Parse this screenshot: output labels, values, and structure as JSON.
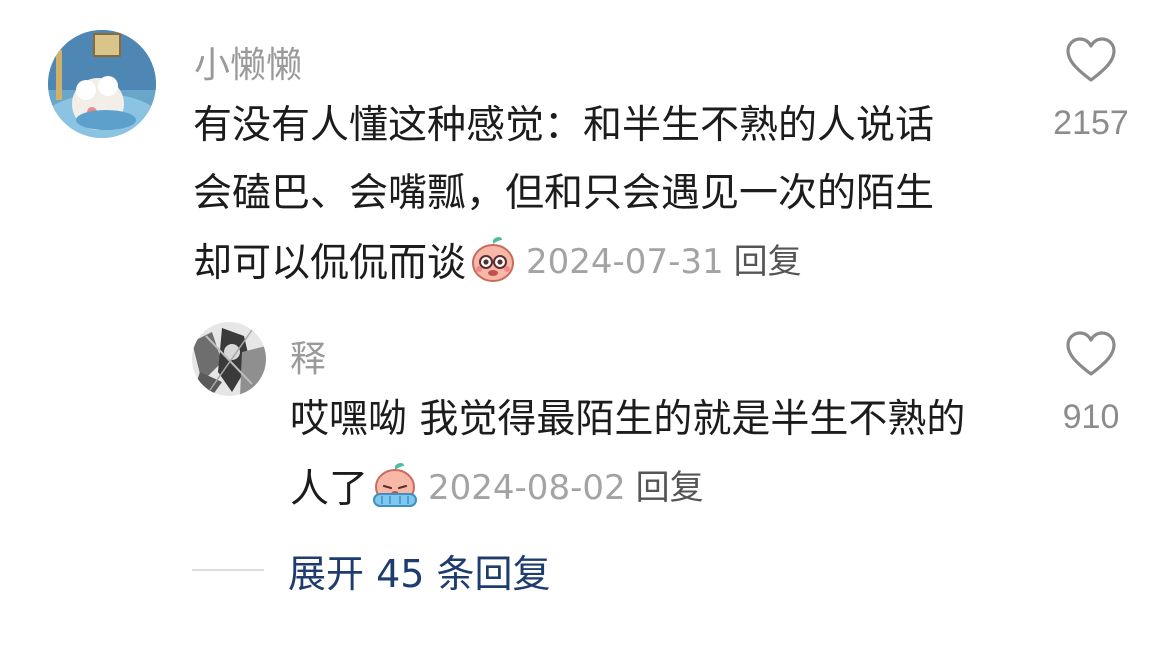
{
  "comment": {
    "username": "小懒懒",
    "text_lines": [
      "有没有人懂这种感觉：和半生不熟的人说话",
      "会磕巴、会嘴瓢，但和只会遇见一次的陌生",
      "却可以侃侃而谈"
    ],
    "emoji": "peach-face-emoji",
    "date": "2024-07-31",
    "reply_label": "回复",
    "like_count": "2157"
  },
  "reply": {
    "username": "释",
    "text_lines": [
      "哎嘿呦 我觉得最陌生的就是半生不熟的",
      "人了"
    ],
    "emoji": "crying-peach-emoji",
    "date": "2024-08-02",
    "reply_label": "回复",
    "like_count": "910"
  },
  "expand": {
    "label": "展开 45 条回复"
  },
  "colors": {
    "username": "#9a9a9a",
    "text": "#1c1c1c",
    "meta": "#a3a3a3",
    "link": "#1f3c6e"
  }
}
